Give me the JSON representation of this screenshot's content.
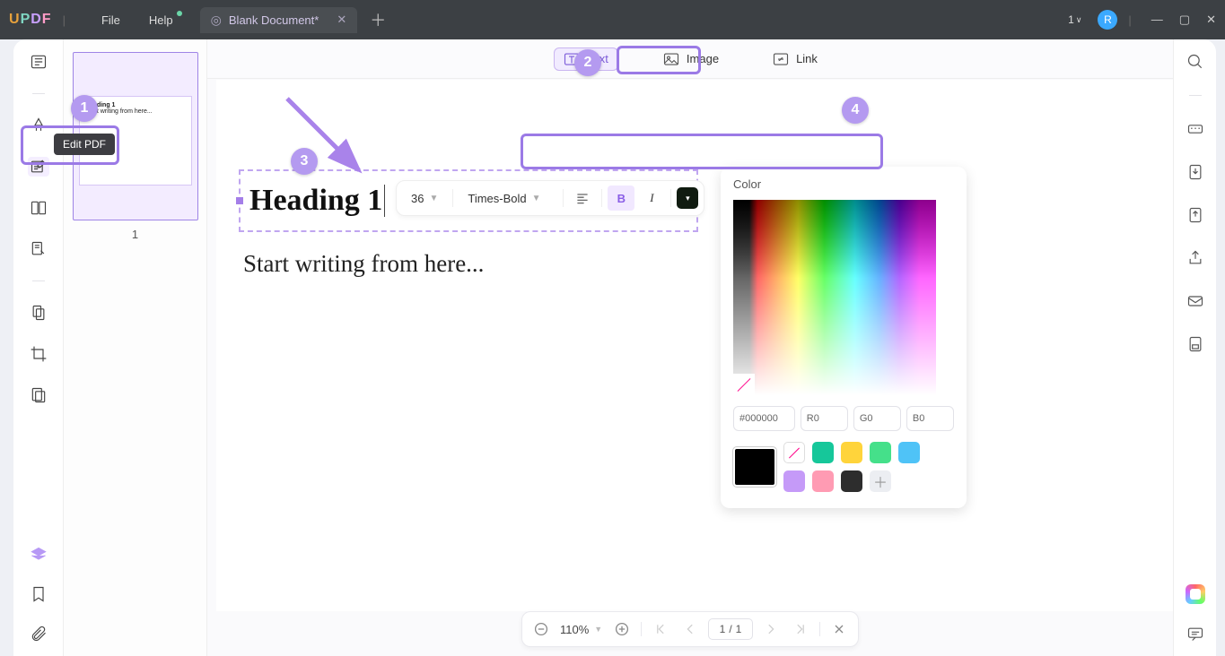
{
  "app": {
    "logo_letters": [
      "U",
      "P",
      "D",
      "F"
    ]
  },
  "menu": {
    "file": "File",
    "help": "Help"
  },
  "tab": {
    "title": "Blank Document*"
  },
  "titlebar": {
    "notif_count": "1",
    "avatar_letter": "R"
  },
  "left_tools": {
    "edit_pdf_tooltip": "Edit PDF"
  },
  "thumbnail": {
    "heading": "Heading 1",
    "body": "Start writing from here...",
    "page_number": "1"
  },
  "top_toolbar": {
    "text_label": "Text",
    "image_label": "Image",
    "link_label": "Link"
  },
  "text_toolbar": {
    "font_size": "36",
    "font_family": "Times-Bold"
  },
  "document": {
    "heading": "Heading 1",
    "body": "Start writing from here..."
  },
  "color_panel": {
    "title": "Color",
    "hex": "000000",
    "r": "0",
    "g": "0",
    "b": "0",
    "swatches": [
      "#16c79a",
      "#ffd43b",
      "#45e08a",
      "#4fc3f7",
      "#c59af8",
      "#ff9bb3",
      "#2d2d2d"
    ]
  },
  "status": {
    "zoom": "110%",
    "page_current": "1",
    "page_total": "1"
  },
  "annotations": {
    "step1": "1",
    "step2": "2",
    "step3": "3",
    "step4": "4"
  }
}
